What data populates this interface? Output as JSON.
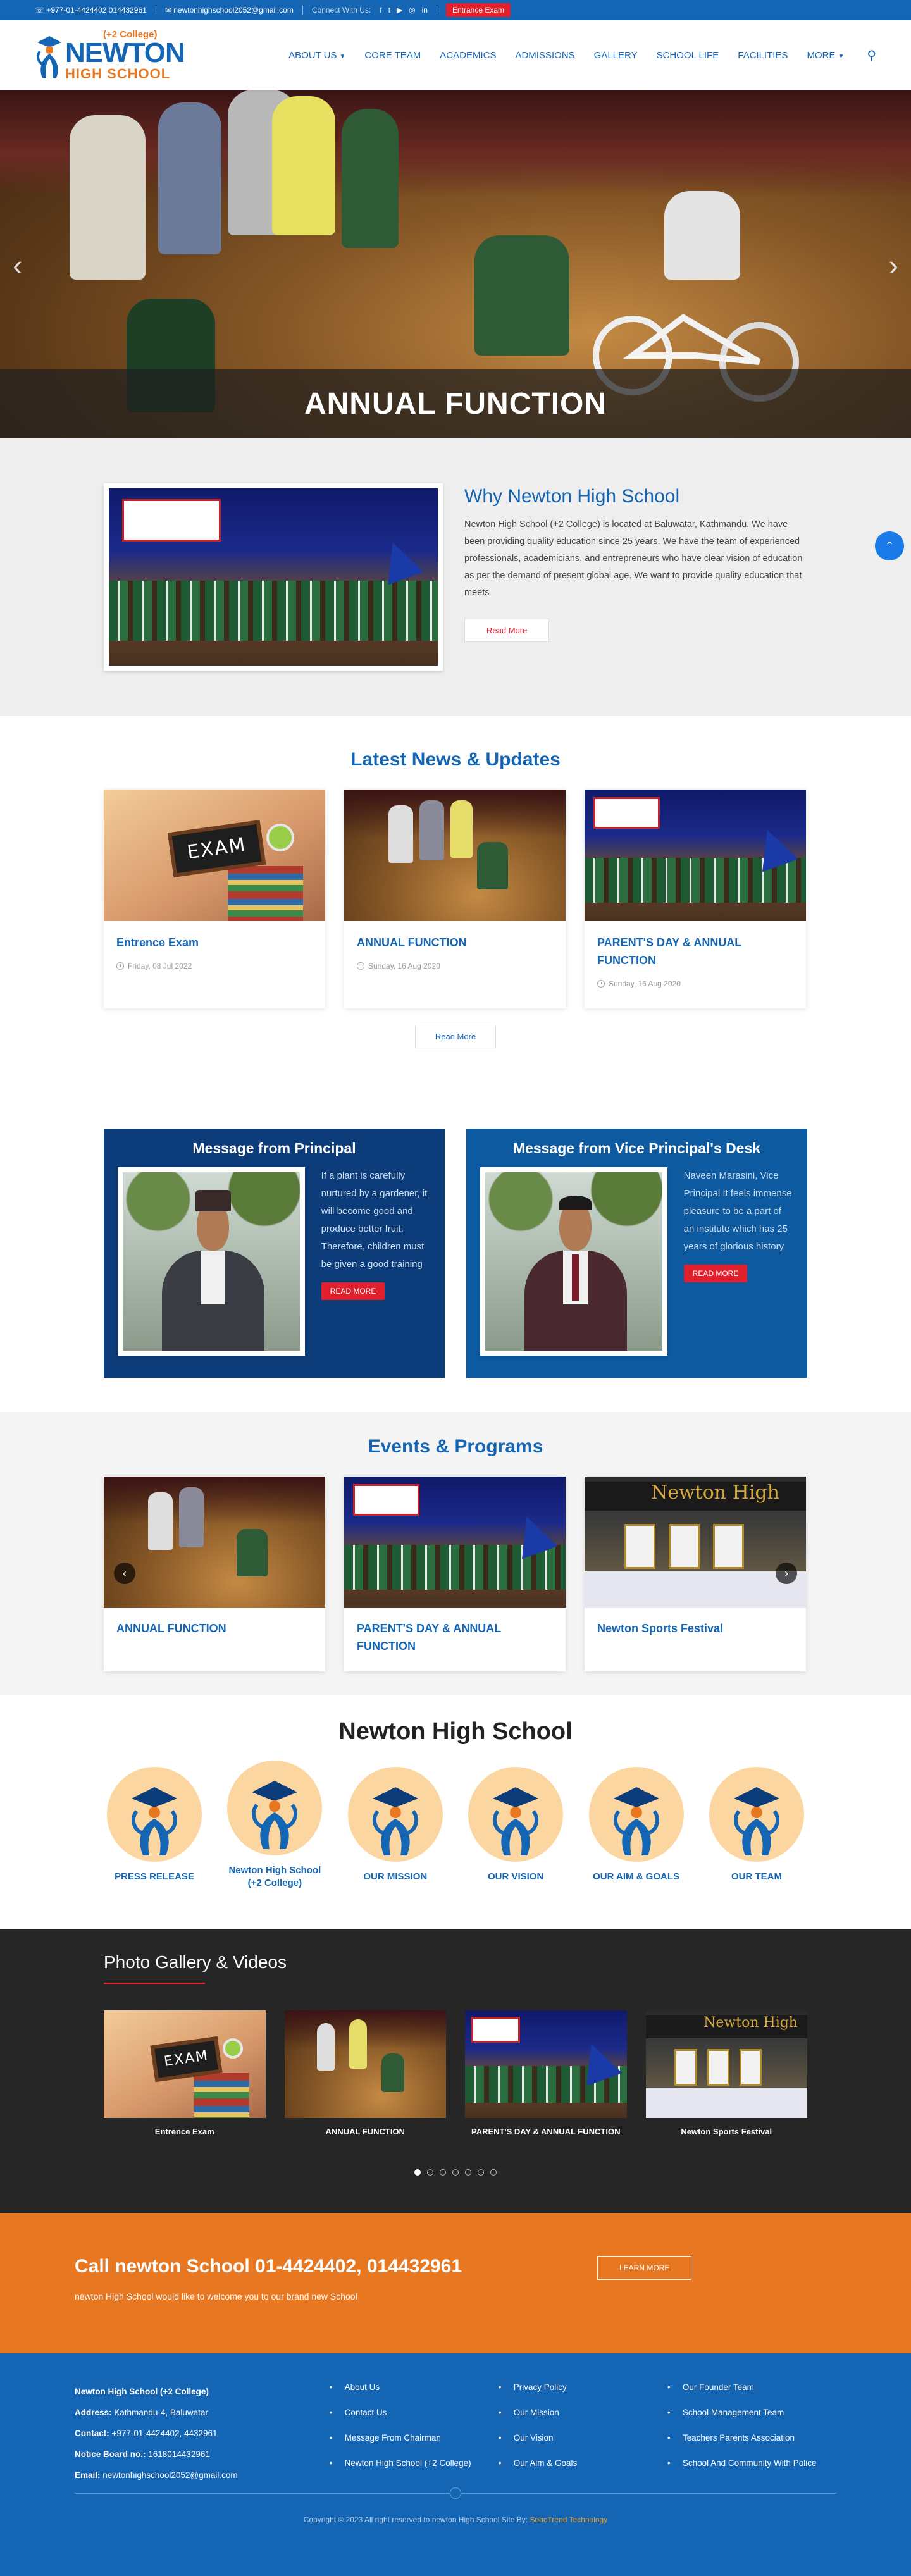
{
  "topbar": {
    "phone": "+977-01-4424402 014432961",
    "email": "newtonhighschool2052@gmail.com",
    "connect": "Connect With Us:",
    "social_icons": [
      "facebook-icon",
      "twitter-icon",
      "youtube-icon",
      "instagram-icon",
      "linkedin-icon"
    ],
    "exam_button": "Entrance Exam"
  },
  "header": {
    "logo_sub": "(+2 College)",
    "logo_name": "NEWTON",
    "logo_hs": "HIGH SCHOOL",
    "nav": [
      {
        "label": "ABOUT US",
        "dropdown": true
      },
      {
        "label": "CORE TEAM",
        "dropdown": false
      },
      {
        "label": "ACADEMICS",
        "dropdown": false
      },
      {
        "label": "ADMISSIONS",
        "dropdown": false
      },
      {
        "label": "GALLERY",
        "dropdown": false
      },
      {
        "label": "SCHOOL LIFE",
        "dropdown": false
      },
      {
        "label": "FACILITIES",
        "dropdown": false
      },
      {
        "label": "MORE",
        "dropdown": true
      }
    ]
  },
  "hero": {
    "caption": "ANNUAL FUNCTION",
    "prev": "‹",
    "next": "›"
  },
  "why": {
    "title": "Why Newton High School",
    "text": "Newton High School (+2 College) is located at Baluwatar, Kathmandu. We have been providing quality education since 25 years. We have the team of experienced professionals, academicians, and entrepreneurs who have clear vision of education as per the demand of present global age. We want to provide quality education that meets",
    "button": "Read More"
  },
  "news": {
    "title": "Latest News & Updates",
    "items": [
      {
        "title": "Entrence Exam",
        "date": "Friday, 08 Jul 2022",
        "photo": "exam"
      },
      {
        "title": "ANNUAL FUNCTION",
        "date": "Sunday, 16 Aug 2020",
        "photo": "function"
      },
      {
        "title": "PARENT'S DAY & ANNUAL FUNCTION",
        "date": "Sunday, 16 Aug 2020",
        "photo": "parade"
      }
    ],
    "button": "Read More"
  },
  "messages": {
    "principal": {
      "title": "Message from Principal",
      "text": "If a plant is carefully nurtured by a gardener, it will become good and produce better fruit. Therefore, children must be given a good training",
      "button": "READ MORE"
    },
    "vice": {
      "title": "Message from Vice Principal's Desk",
      "text": "Naveen Marasini, Vice Principal It feels immense pleasure to be a part of an institute which has 25 years of glorious history",
      "button": "READ MORE"
    }
  },
  "events": {
    "title": "Events & Programs",
    "items": [
      {
        "title": "ANNUAL FUNCTION",
        "photo": "function"
      },
      {
        "title": "PARENT'S DAY & ANNUAL FUNCTION",
        "photo": "parade"
      },
      {
        "title": "Newton Sports Festival",
        "photo": "sports"
      }
    ],
    "prev": "‹",
    "next": "›"
  },
  "school": {
    "title": "Newton High School",
    "items": [
      {
        "label": "PRESS RELEASE"
      },
      {
        "label": "Newton High School (+2 College)"
      },
      {
        "label": "OUR MISSION"
      },
      {
        "label": "OUR VISION"
      },
      {
        "label": "OUR AIM & GOALS"
      },
      {
        "label": "OUR TEAM"
      }
    ]
  },
  "gallery": {
    "title": "Photo Gallery & Videos",
    "items": [
      {
        "caption": "Entrence Exam",
        "photo": "exam"
      },
      {
        "caption": "ANNUAL FUNCTION",
        "photo": "function"
      },
      {
        "caption": "PARENT'S DAY & ANNUAL FUNCTION",
        "photo": "parade"
      },
      {
        "caption": "Newton Sports Festival",
        "photo": "sports"
      }
    ],
    "dots": 7,
    "active_dot": 0
  },
  "cta": {
    "title": "Call newton School 01-4424402, 014432961",
    "text": "newton High School would like to welcome you to our brand new School",
    "button": "LEARN MORE"
  },
  "footer": {
    "name": "Newton High School (+2 College)",
    "address_label": "Address",
    "address": "Kathmandu-4, Baluwatar",
    "contact_label": "Contact",
    "contact": "+977-01-4424402, 4432961",
    "notice_label": "Notice Board no.",
    "notice": "1618014432961",
    "email_label": "Email",
    "email": "newtonhighschool2052@gmail.com",
    "col1": [
      "About Us",
      "Contact Us",
      "Message From Chairman",
      "Newton High School (+2 College)"
    ],
    "col2": [
      "Privacy Policy",
      "Our Mission",
      "Our Vision",
      "Our Aim & Goals"
    ],
    "col3": [
      "Our Founder Team",
      "School Management Team",
      "Teachers Parents Association",
      "School And Community With Police"
    ],
    "copyright": "Copyright © 2023 All right reserved to newton High School Site By:",
    "credit": "SoboTrend Technology"
  },
  "scroll_top": "⌃",
  "colors": {
    "primary": "#1565b5",
    "accent": "#e87722",
    "red": "#e0202c",
    "dark": "#262626"
  }
}
